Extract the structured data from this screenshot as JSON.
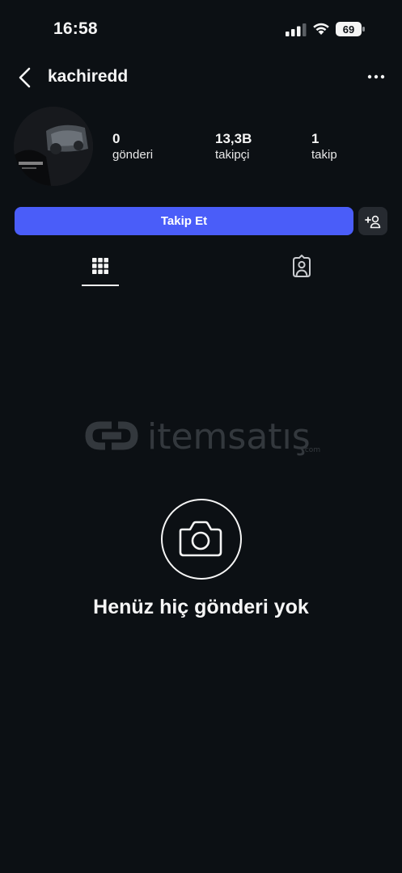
{
  "status_bar": {
    "time": "16:58",
    "battery": "69",
    "icons": [
      "signal-icon",
      "wifi-icon",
      "battery-icon"
    ]
  },
  "header": {
    "username": "kachiredd",
    "back_icon": "chevron-left-icon",
    "more_icon": "ellipsis-icon"
  },
  "profile": {
    "stats": [
      {
        "value": "0",
        "label": "gönderi"
      },
      {
        "value": "13,3B",
        "label": "takipçi"
      },
      {
        "value": "1",
        "label": "takip"
      }
    ]
  },
  "actions": {
    "follow_label": "Takip Et",
    "suggest_icon": "add-person-icon"
  },
  "tabs": {
    "active": "grid-icon",
    "items": [
      "grid-icon",
      "tagged-person-icon"
    ]
  },
  "watermark": {
    "brand": "itemsatış",
    "domain": ".com"
  },
  "empty_state": {
    "icon": "camera-icon",
    "message": "Henüz hiç gönderi yok"
  },
  "colors": {
    "background": "#0c1014",
    "accent": "#4a5df9",
    "secondary_button": "#262a30",
    "text": "#f5f5f5"
  }
}
